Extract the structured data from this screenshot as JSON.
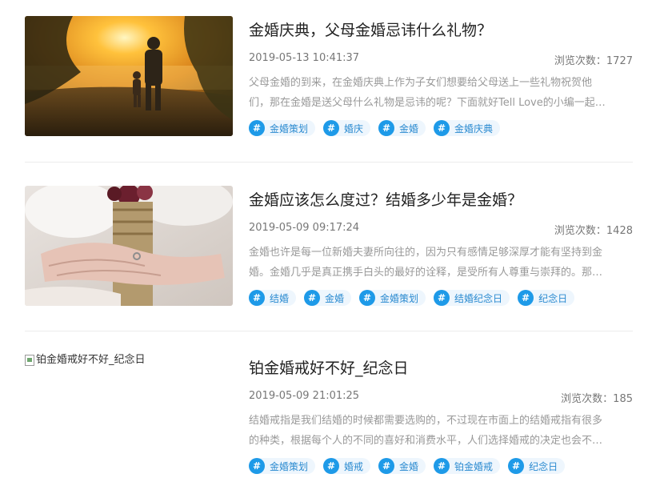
{
  "articles": [
    {
      "title": "金婚庆典，父母金婚忌讳什么礼物？",
      "date": "2019-05-13 10:41:37",
      "views": "浏览次数：1727",
      "excerpt_line1": "父母金婚的到来，在金婚庆典上作为子女们想要给父母送上一些礼物祝贺他",
      "excerpt_line2": "们，那在金婚是送父母什么礼物是忌讳的呢？下面就好Tell Love的小编一起…",
      "image": "sunset-father-child-photo",
      "tags": [
        "金婚策划",
        "婚庆",
        "金婚",
        "金婚庆典"
      ]
    },
    {
      "title": "金婚应该怎么度过？结婚多少年是金婚？",
      "date": "2019-05-09 09:17:24",
      "views": "浏览次数：1428",
      "excerpt_line1": "金婚也许是每一位新婚夫妻所向往的，因为只有感情足够深厚才能有坚持到金",
      "excerpt_line2": "婚。金婚几乎是真正携手白头的最好的诠释，是受所有人尊重与崇拜的。那…",
      "image": "hands-bouquet-photo",
      "tags": [
        "结婚",
        "金婚",
        "金婚策划",
        "结婚纪念日",
        "纪念日"
      ]
    },
    {
      "title": "铂金婚戒好不好_纪念日",
      "date": "2019-05-09 21:01:25",
      "views": "浏览次数：185",
      "excerpt_line1": "结婚戒指是我们结婚的时候都需要选购的，不过现在市面上的结婚戒指有很多",
      "excerpt_line2": "的种类，根据每个人的不同的喜好和消费水平，人们选择婚戒的决定也会不…",
      "image_alt": "铂金婚戒好不好_纪念日",
      "tags": [
        "金婚策划",
        "婚戒",
        "金婚",
        "铂金婚戒",
        "纪念日"
      ]
    }
  ],
  "tag_icon": "#",
  "colors": {
    "tag_icon_bg": "#1e9ae8",
    "tag_bg": "#eef6fd",
    "tag_text": "#2a8ad0"
  }
}
